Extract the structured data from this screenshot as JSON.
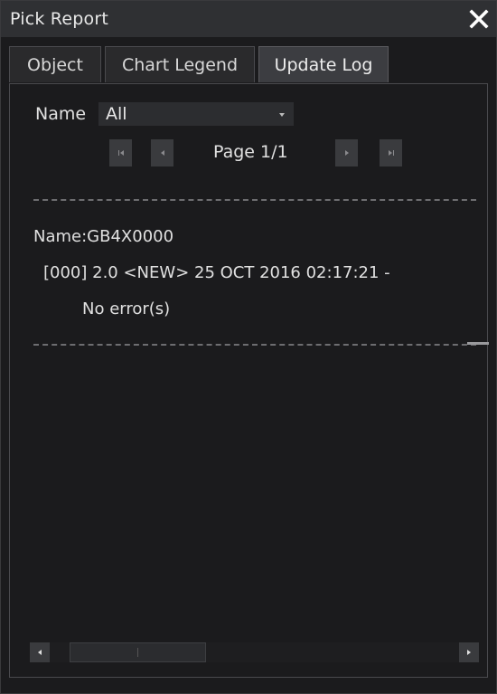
{
  "window": {
    "title": "Pick Report",
    "close_icon": "close-icon"
  },
  "tabs": [
    {
      "label": "Object",
      "active": false
    },
    {
      "label": "Chart Legend",
      "active": false
    },
    {
      "label": "Update Log",
      "active": true
    }
  ],
  "filter": {
    "label": "Name",
    "selected": "All"
  },
  "pager": {
    "page_text": "Page 1/1",
    "icons": [
      "first-page-icon",
      "prev-page-icon",
      "next-page-icon",
      "last-page-icon"
    ]
  },
  "log": {
    "name": "Name:GB4X0000",
    "entry": "[000] 2.0 <NEW> 25 OCT 2016 02:17:21 -",
    "status": "No error(s)"
  },
  "colors": {
    "background": "#1b1b1d",
    "titlebar": "#2f3033",
    "active_tab": "#3c3d41",
    "text": "#e0e0e0"
  }
}
